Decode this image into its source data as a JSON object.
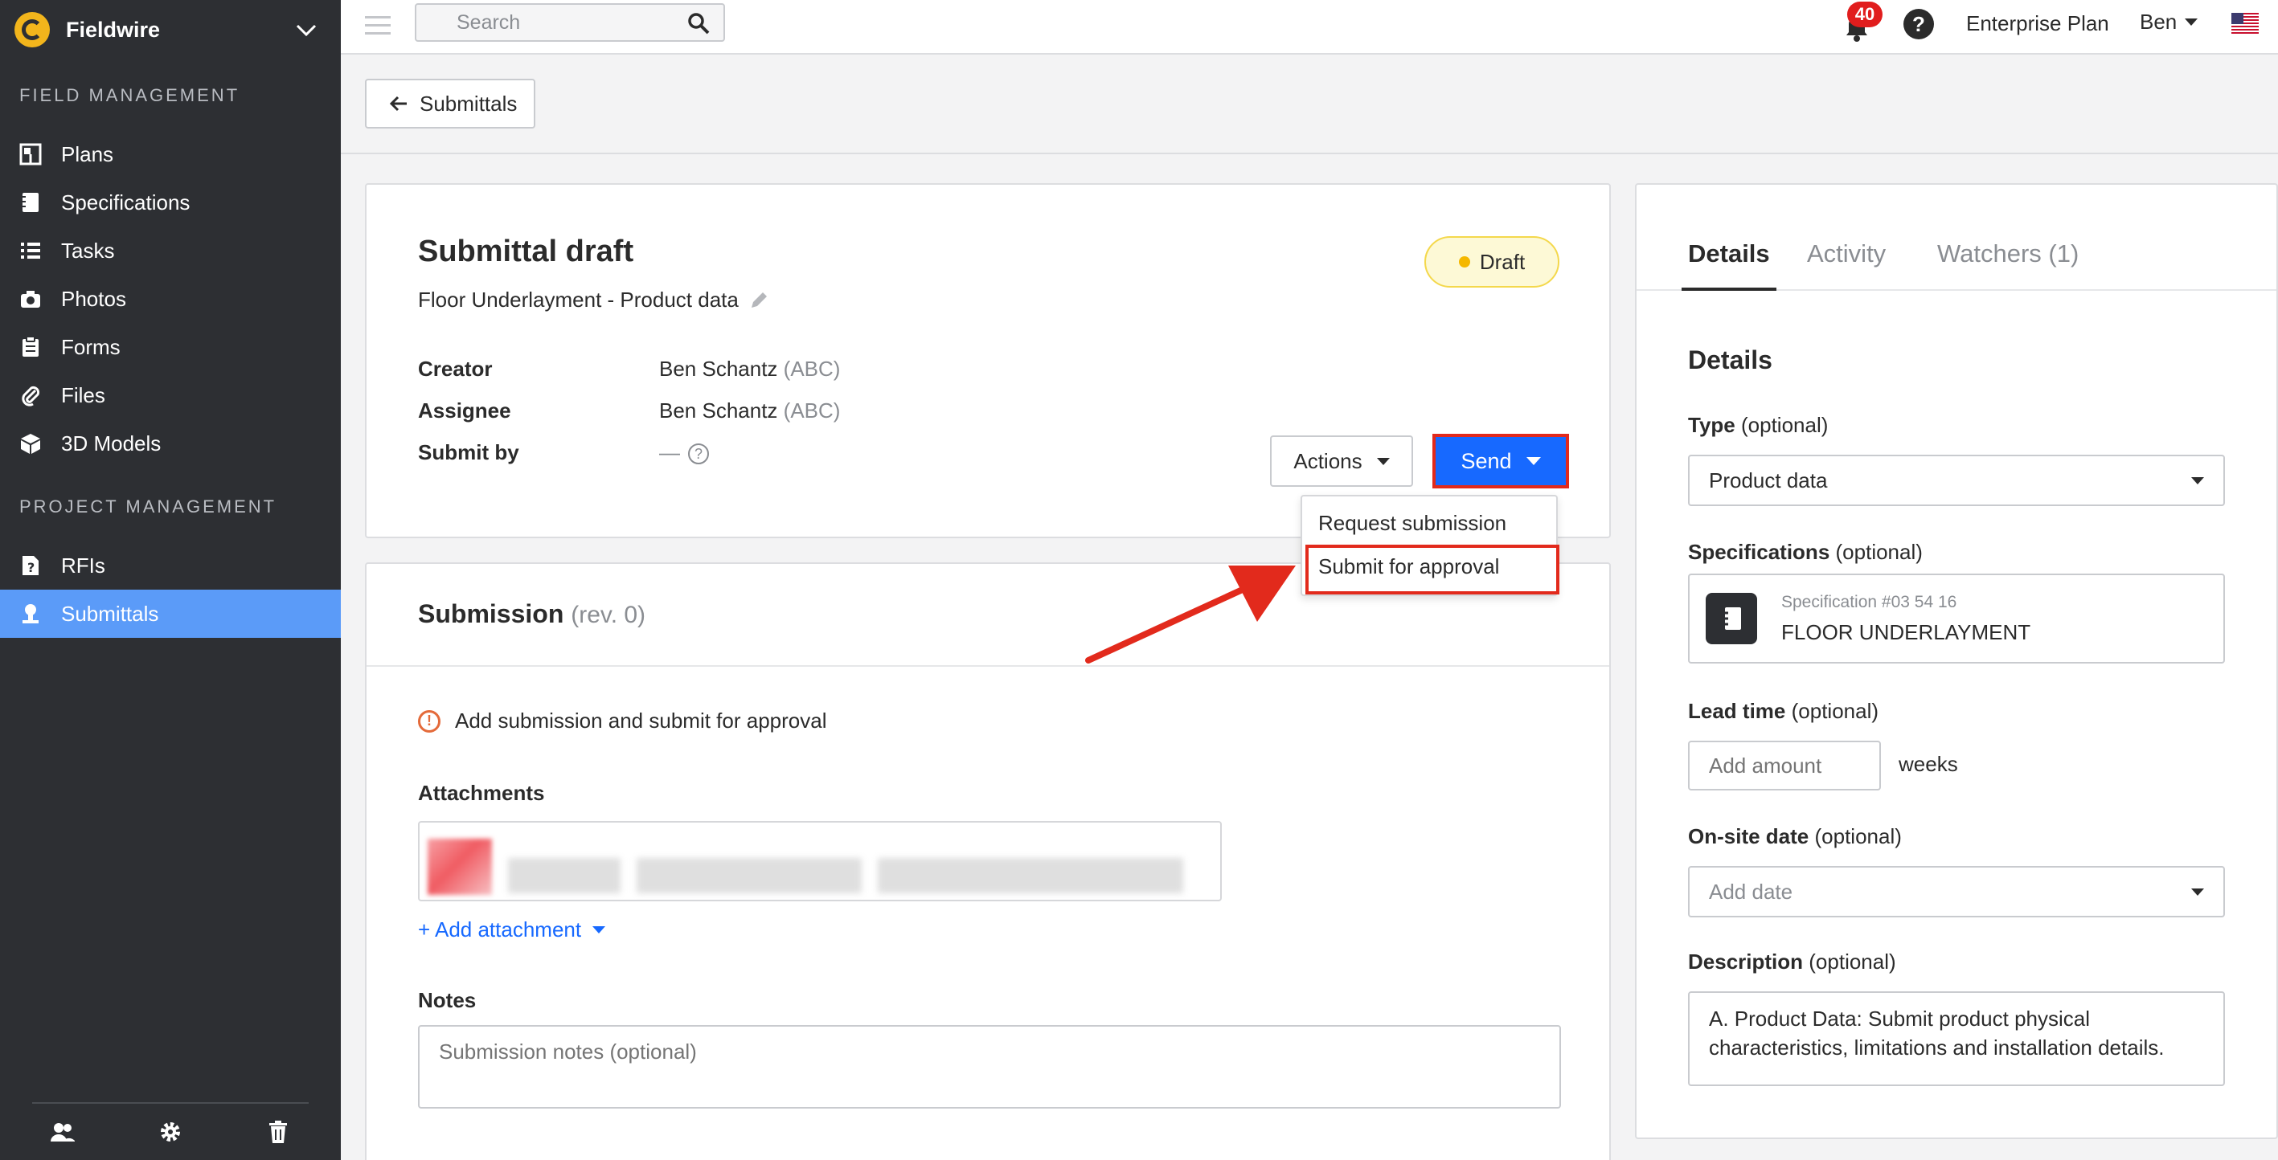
{
  "sidebar": {
    "brand": "Fieldwire",
    "section_field": "FIELD MANAGEMENT",
    "section_project": "PROJECT MANAGEMENT",
    "items": [
      {
        "label": "Plans",
        "icon": "plans-icon"
      },
      {
        "label": "Specifications",
        "icon": "specifications-icon"
      },
      {
        "label": "Tasks",
        "icon": "tasks-icon"
      },
      {
        "label": "Photos",
        "icon": "camera-icon"
      },
      {
        "label": "Forms",
        "icon": "forms-icon"
      },
      {
        "label": "Files",
        "icon": "paperclip-icon"
      },
      {
        "label": "3D Models",
        "icon": "cube-icon"
      },
      {
        "label": "RFIs",
        "icon": "rfi-icon"
      },
      {
        "label": "Submittals",
        "icon": "submittals-icon",
        "active": true
      }
    ]
  },
  "topbar": {
    "search_placeholder": "Search",
    "notifications": "40",
    "help": "?",
    "plan": "Enterprise Plan",
    "user": "Ben"
  },
  "back_button": "Submittals",
  "draft": {
    "title": "Submittal draft",
    "subtitle": "Floor Underlayment - Product data",
    "status": "Draft",
    "creator_label": "Creator",
    "creator_name": "Ben Schantz",
    "creator_org": "(ABC)",
    "assignee_label": "Assignee",
    "assignee_name": "Ben Schantz",
    "assignee_org": "(ABC)",
    "submit_by_label": "Submit by",
    "submit_by_value": "—",
    "actions_label": "Actions",
    "send_label": "Send"
  },
  "send_menu": {
    "items": [
      "Request submission",
      "Submit for approval"
    ],
    "highlighted": "Submit for approval"
  },
  "submission": {
    "title": "Submission",
    "rev": "(rev. 0)",
    "warning": "Add submission and submit for approval",
    "attachments_label": "Attachments",
    "add_attachment": "+ Add attachment",
    "notes_label": "Notes",
    "notes_placeholder": "Submission notes (optional)"
  },
  "details": {
    "tabs": [
      "Details",
      "Activity",
      "Watchers (1)"
    ],
    "active_tab": "Details",
    "title": "Details",
    "type_label": "Type",
    "type_opt": "(optional)",
    "type_value": "Product data",
    "spec_label": "Specifications",
    "spec_opt": "(optional)",
    "spec_number": "Specification #03 54 16",
    "spec_name": "FLOOR UNDERLAYMENT",
    "lead_label": "Lead time",
    "lead_opt": "(optional)",
    "lead_placeholder": "Add amount",
    "lead_unit": "weeks",
    "onsite_label": "On-site date",
    "onsite_opt": "(optional)",
    "onsite_placeholder": "Add date",
    "desc_label": "Description",
    "desc_opt": "(optional)",
    "desc_value": "A. Product Data:  Submit product physical characteristics, limitations and installation details."
  },
  "colors": {
    "sidebar_bg": "#2d2f33",
    "active_nav": "#5b9bf8",
    "primary": "#1769ff",
    "highlight_red": "#e22a1c",
    "badge_red": "#e11d1d"
  }
}
